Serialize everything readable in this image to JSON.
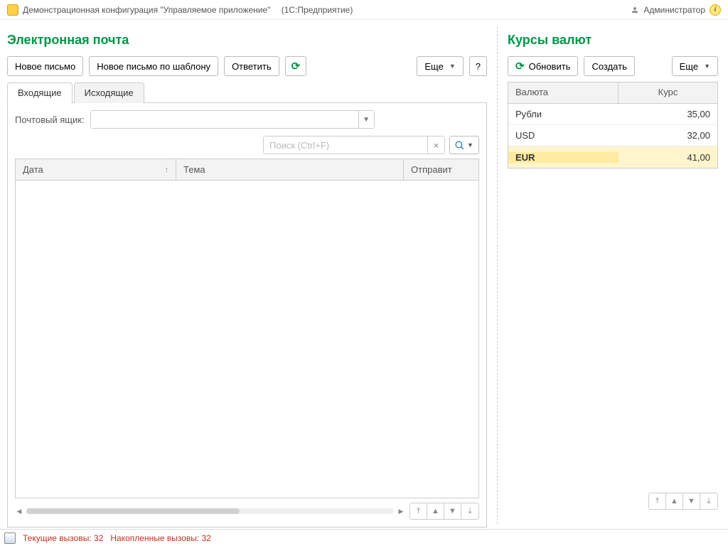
{
  "titlebar": {
    "config_name": "Демонстрационная конфигурация \"Управляемое приложение\"",
    "platform": "(1С:Предприятие)",
    "user": "Администратор"
  },
  "email": {
    "title": "Электронная почта",
    "toolbar": {
      "new": "Новое письмо",
      "new_template": "Новое письмо по шаблону",
      "reply": "Ответить",
      "more": "Еще",
      "help": "?"
    },
    "tabs": {
      "inbox": "Входящие",
      "outbox": "Исходящие"
    },
    "mailbox_label": "Почтовый ящик:",
    "search_placeholder": "Поиск (Ctrl+F)",
    "columns": {
      "date": "Дата",
      "subject": "Тема",
      "sender": "Отправит"
    }
  },
  "currency": {
    "title": "Курсы валют",
    "toolbar": {
      "refresh": "Обновить",
      "create": "Создать",
      "more": "Еще"
    },
    "columns": {
      "name": "Валюта",
      "rate": "Курс"
    },
    "rows": [
      {
        "name": "Рубли",
        "rate": "35,00"
      },
      {
        "name": "USD",
        "rate": "32,00"
      },
      {
        "name": "EUR",
        "rate": "41,00"
      }
    ],
    "selected_index": 2
  },
  "statusbar": {
    "current_label": "Текущие вызовы:",
    "current_value": "32",
    "accum_label": "Накопленные вызовы:",
    "accum_value": "32"
  }
}
